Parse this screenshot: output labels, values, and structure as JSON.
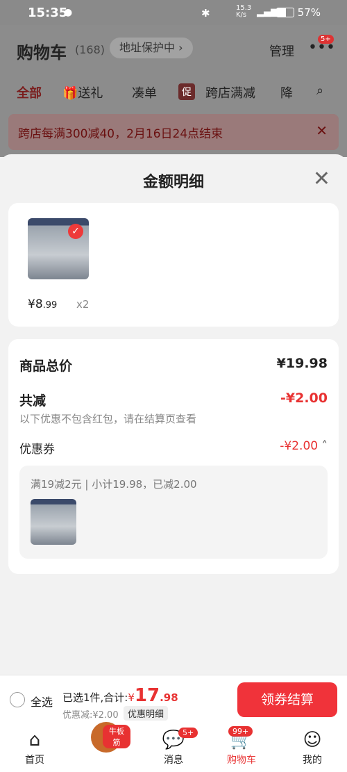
{
  "status_bar": {
    "time": "15:35",
    "net_speed": "15.3 K/s",
    "battery": "57%"
  },
  "header": {
    "title": "购物车",
    "count": "(168)",
    "address_protect": "地址保护中",
    "manage": "管理",
    "more_badge": "5+"
  },
  "tabs": [
    "全部",
    "送礼",
    "凑单",
    "跨店满减",
    "降"
  ],
  "tab_pill": "促",
  "promo": {
    "text": "跨店每满300减40，2月16日24点结束"
  },
  "sheet": {
    "title": "金额明细",
    "item": {
      "price_int": "¥8",
      "price_dec": ".99",
      "qty": "x2"
    },
    "total_label": "商品总价",
    "total_value": "¥19.98",
    "discount_label": "共减",
    "discount_value": "-¥2.00",
    "discount_note": "以下优惠不包含红包，请在结算页查看",
    "coupon_label": "优惠券",
    "coupon_value": "-¥2.00",
    "coupon_detail": "满19减2元 | 小计19.98，已减2.00"
  },
  "bottom_bar": {
    "select_all": "全选",
    "selected_summary": "已选1件,合计:",
    "total_currency": "¥",
    "total_int": "17",
    "total_dec": ".98",
    "discount_text": "优惠减:¥2.00",
    "detail_button": "优惠明细",
    "checkout_button": "领券结算"
  },
  "nav": {
    "items": [
      {
        "label": "首页"
      },
      {
        "label": "牛板筋"
      },
      {
        "label": "消息",
        "badge": "5+"
      },
      {
        "label": "购物车",
        "badge": "99+"
      },
      {
        "label": "我的"
      }
    ]
  },
  "colors": {
    "accent": "#e83232",
    "checkout": "#f0333a"
  }
}
